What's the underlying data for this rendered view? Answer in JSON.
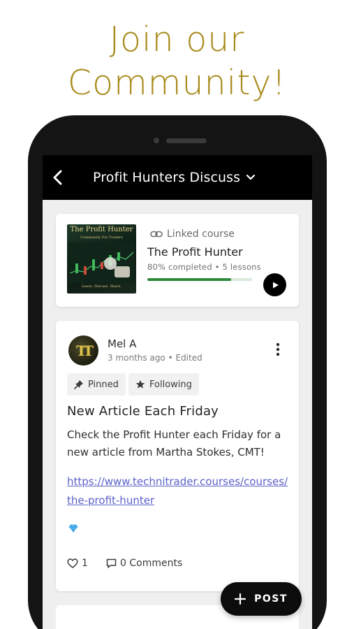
{
  "promo": {
    "headline_line1": "Join our",
    "headline_line2": "Community!"
  },
  "appbar": {
    "title": "Profit Hunters Discuss"
  },
  "course": {
    "linked_label": "Linked course",
    "title": "The Profit Hunter",
    "meta": "80% completed • 5 lessons",
    "progress": 0.8,
    "thumbnail": {
      "title": "The Profit Hunter",
      "subtitle": "Community For Traders",
      "footer": "Learn. Discuss. Share."
    }
  },
  "post": {
    "author": "Mel A",
    "meta": "3 months ago • Edited",
    "chips": {
      "pinned": "Pinned",
      "following": "Following"
    },
    "title": "New Article Each Friday",
    "body": "Check the Profit Hunter each Friday for a new article from Martha Stokes, CMT!",
    "link": "https://www.technitrader.courses/courses/the-profit-hunter",
    "likes": "1",
    "comments": "0 Comments"
  },
  "fab": {
    "label": "POST"
  },
  "colors": {
    "headline": "#a88a1b",
    "appbar": "#000000",
    "progress": "#2e8b3d",
    "link": "#5b62c9",
    "gem": "#4fb3f6"
  }
}
